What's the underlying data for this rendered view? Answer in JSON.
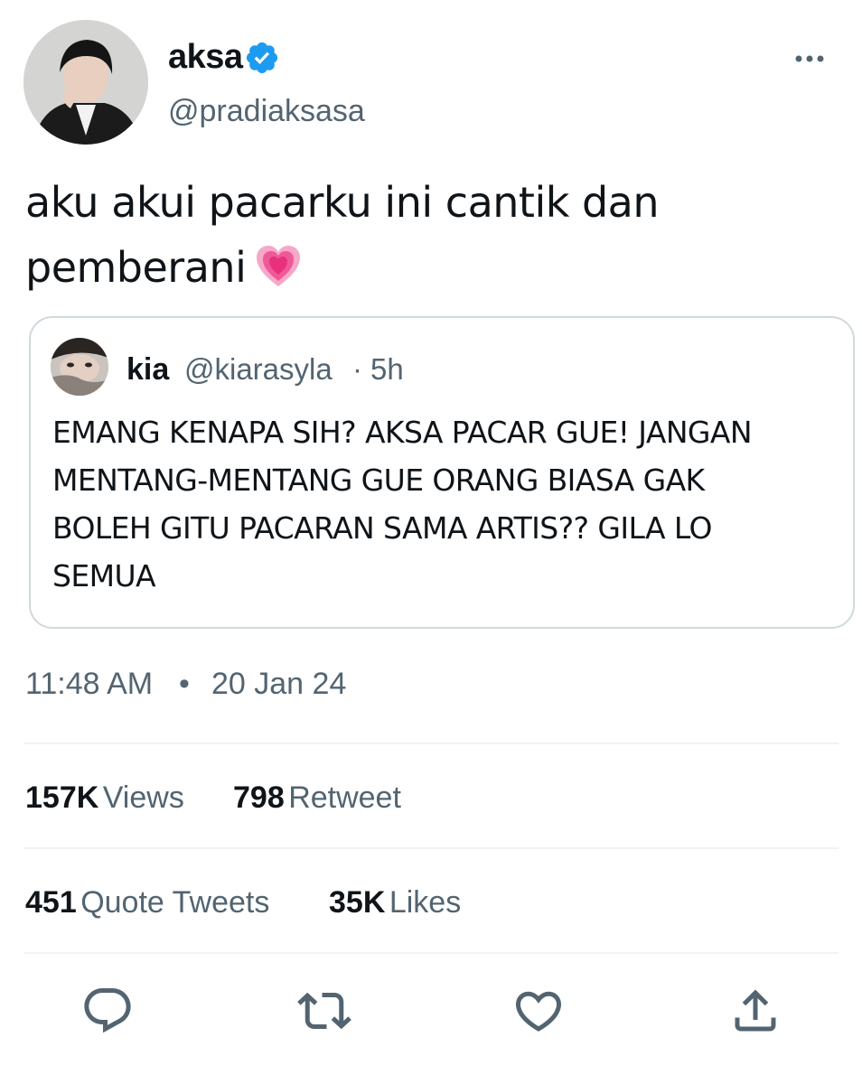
{
  "tweet": {
    "author": {
      "display_name": "aksa",
      "handle": "@pradiaksasa",
      "verified": true,
      "verified_color": "#1d9bf0"
    },
    "text_line_1": "aku akui pacarku ini cantik dan",
    "text_line_2": "pemberani",
    "emoji": "growing-heart-icon",
    "quote": {
      "display_name": "kia",
      "handle": "@kiarasyla",
      "separator": "·",
      "time_ago": "5h",
      "text_lines": [
        "EMANG KENAPA SIH? AKSA PACAR GUE! JANGAN",
        "MENTANG-MENTANG GUE ORANG BIASA GAK",
        "BOLEH GITU PACARAN SAMA ARTIS?? GILA LO",
        "SEMUA"
      ]
    },
    "timestamp": {
      "time": "11:48 AM",
      "separator": "•",
      "date": "20 Jan 24"
    },
    "stats": {
      "views_count": "157K",
      "views_label": "Views",
      "retweets_count": "798",
      "retweets_label": "Retweet",
      "quotes_count": "451",
      "quotes_label": "Quote Tweets",
      "likes_count": "35K",
      "likes_label": "Likes"
    },
    "actions": [
      "reply-icon",
      "retweet-icon",
      "like-icon",
      "share-icon"
    ]
  },
  "colors": {
    "text_primary": "#0f1419",
    "text_secondary": "#536471",
    "border": "#cfd9de",
    "divider": "#eff3f4",
    "accent": "#1d9bf0"
  }
}
